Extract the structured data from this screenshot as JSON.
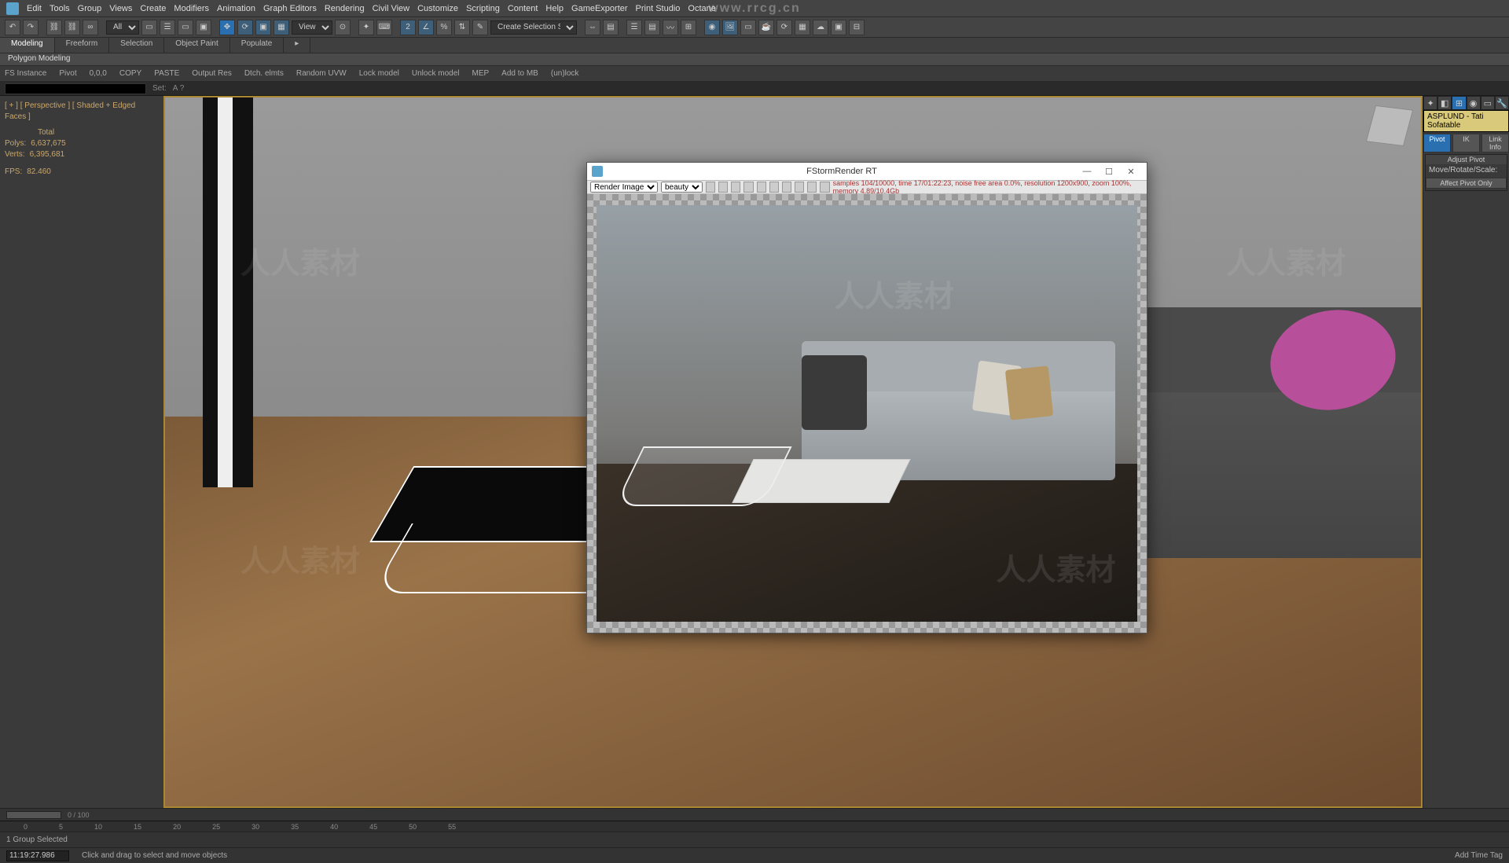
{
  "watermark_url": "www.rrcg.cn",
  "watermark_text": "人人素材",
  "menubar": {
    "items": [
      "Edit",
      "Tools",
      "Group",
      "Views",
      "Create",
      "Modifiers",
      "Animation",
      "Graph Editors",
      "Rendering",
      "Civil View",
      "Customize",
      "Scripting",
      "Content",
      "Help",
      "GameExporter",
      "Print Studio",
      "Octane"
    ]
  },
  "toolbar": {
    "ref_sys": "View",
    "sel_filter": "All",
    "named_sel": "Create Selection Se"
  },
  "ribbon": {
    "tabs": [
      "Modeling",
      "Freeform",
      "Selection",
      "Object Paint",
      "Populate"
    ],
    "active": "Modeling",
    "sub": "Polygon Modeling"
  },
  "toolbar2": {
    "items": [
      "FS Instance",
      "Pivot",
      "0,0,0",
      "COPY",
      "PASTE",
      "Output Res",
      "Dtch. elmts",
      "Random UVW",
      "Lock model",
      "Unlock model",
      "MEP",
      "Add to MB",
      "(un)lock"
    ]
  },
  "toolbar3": {
    "label1": "Set:",
    "label2": "A ?"
  },
  "viewport": {
    "label": "[ + ] [ Perspective ] [ Shaded + Edged Faces ]",
    "stats_header": "Total",
    "polys_label": "Polys:",
    "polys": "6,637,675",
    "verts_label": "Verts:",
    "verts": "6,395,681",
    "fps_label": "FPS:",
    "fps": "82.460"
  },
  "cmdpanel": {
    "objname": "ASPLUND - Tati Sofatable",
    "btns": {
      "pivot": "Pivot",
      "ik": "IK",
      "link": "Link Info"
    },
    "rollout1": "Adjust Pivot",
    "row1": "Move/Rotate/Scale:",
    "row2": "Affect Pivot Only"
  },
  "timeline": {
    "pos": "0 / 100",
    "ticks": [
      "0",
      "5",
      "10",
      "15",
      "20",
      "25",
      "30",
      "35",
      "40",
      "45",
      "50",
      "55"
    ]
  },
  "status": {
    "selection": "1 Group Selected",
    "time": "11:19:27.986",
    "prompt": "Click and drag to select and move objects",
    "add_time": "Add Time Tag"
  },
  "renderwin": {
    "title": "FStormRender RT",
    "dd1": "Render Image",
    "dd2": "beauty",
    "info": "samples 104/10000,   time 17/01:22:23,   noise free area 0.0%,   resolution 1200x900,   zoom 100%,   memory 4.89/10.4Gb"
  }
}
